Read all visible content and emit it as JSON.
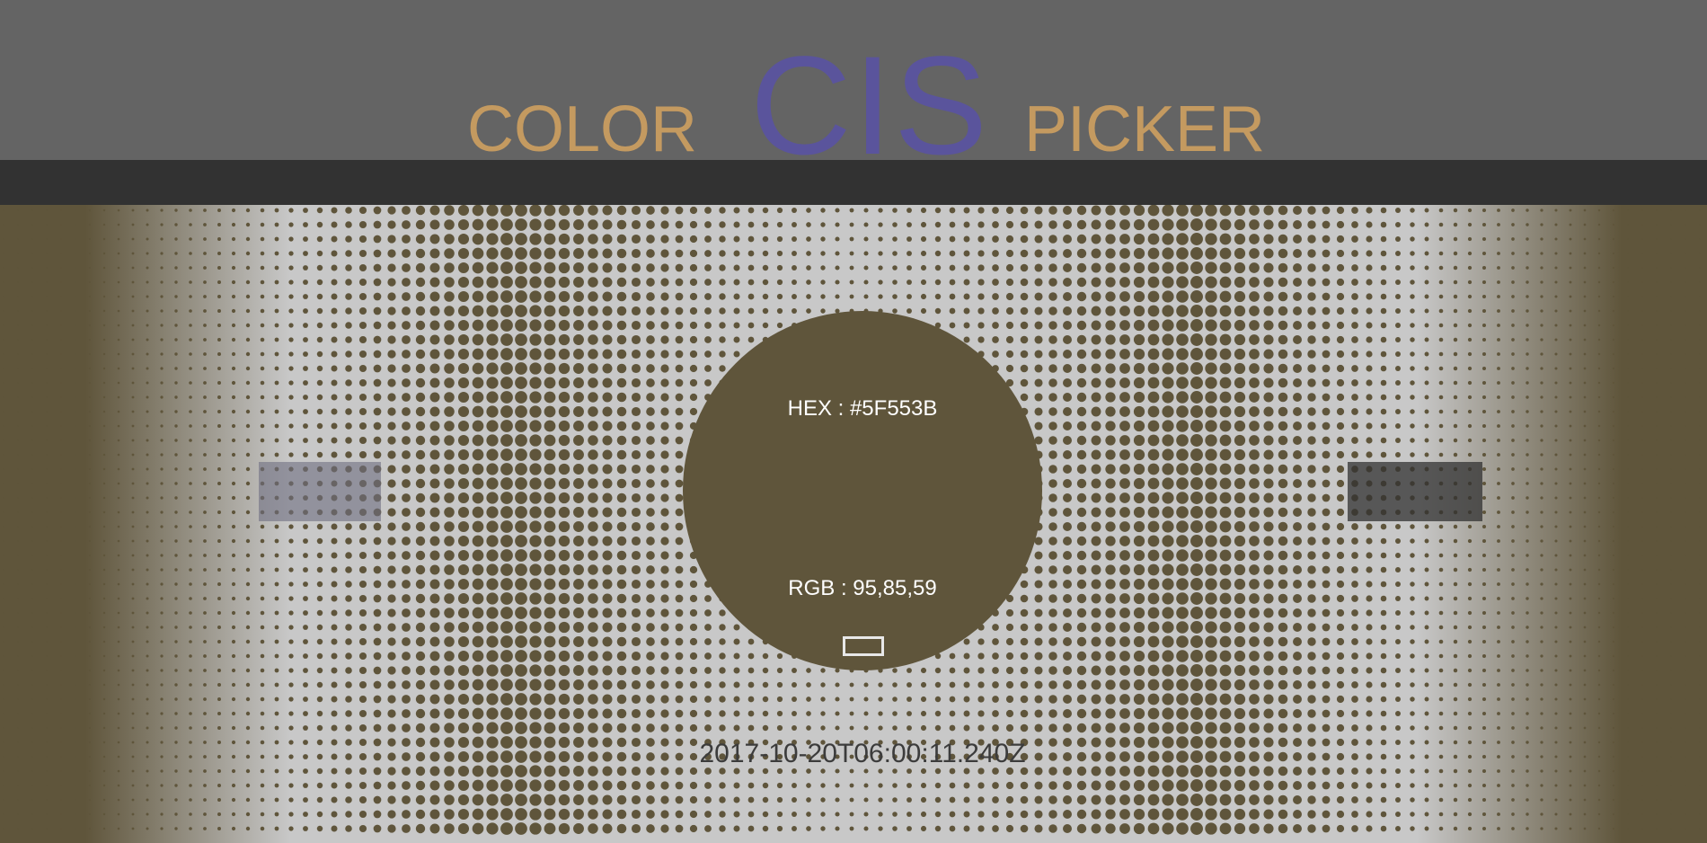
{
  "header": {
    "title_left": "COLOR",
    "title_center": "CIS",
    "title_right": "PICKER"
  },
  "color": {
    "hex_label": "HEX : #5F553B",
    "rgb_label": "RGB : 95,85,59"
  },
  "nav": {
    "previous_label": "",
    "next_label": ""
  },
  "timestamp": "2017-10-20T06:00:11.240Z",
  "colors": {
    "swatch": "#5F553B",
    "header_bg": "#646464",
    "bar_bg": "#323232",
    "title_accent": "#C49A60",
    "title_cis": "#5A549C",
    "pattern_light": "#C8C8C8"
  },
  "icons": {
    "copy": "copy-rectangle-icon"
  }
}
